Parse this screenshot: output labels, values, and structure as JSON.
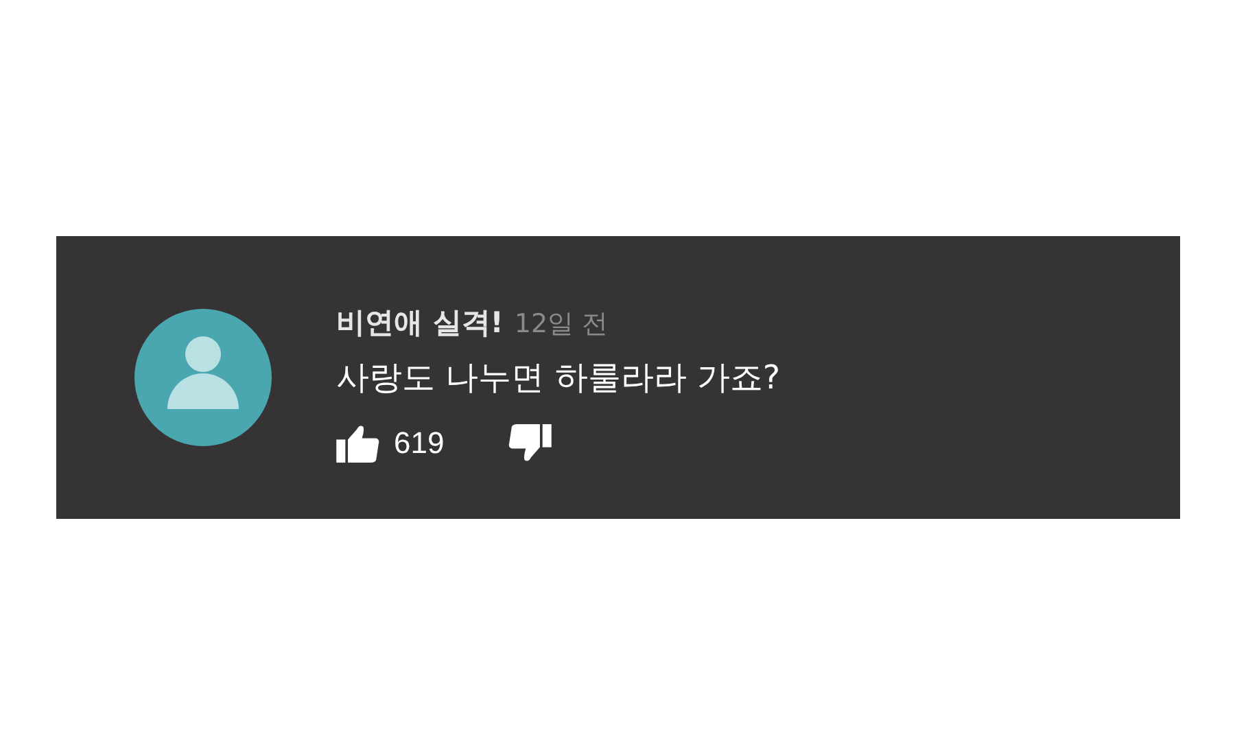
{
  "comment": {
    "author": "비연애 실격!",
    "time": "12일 전",
    "text": "사랑도 나누면 하룰라라 가죠?",
    "likes": "619"
  }
}
